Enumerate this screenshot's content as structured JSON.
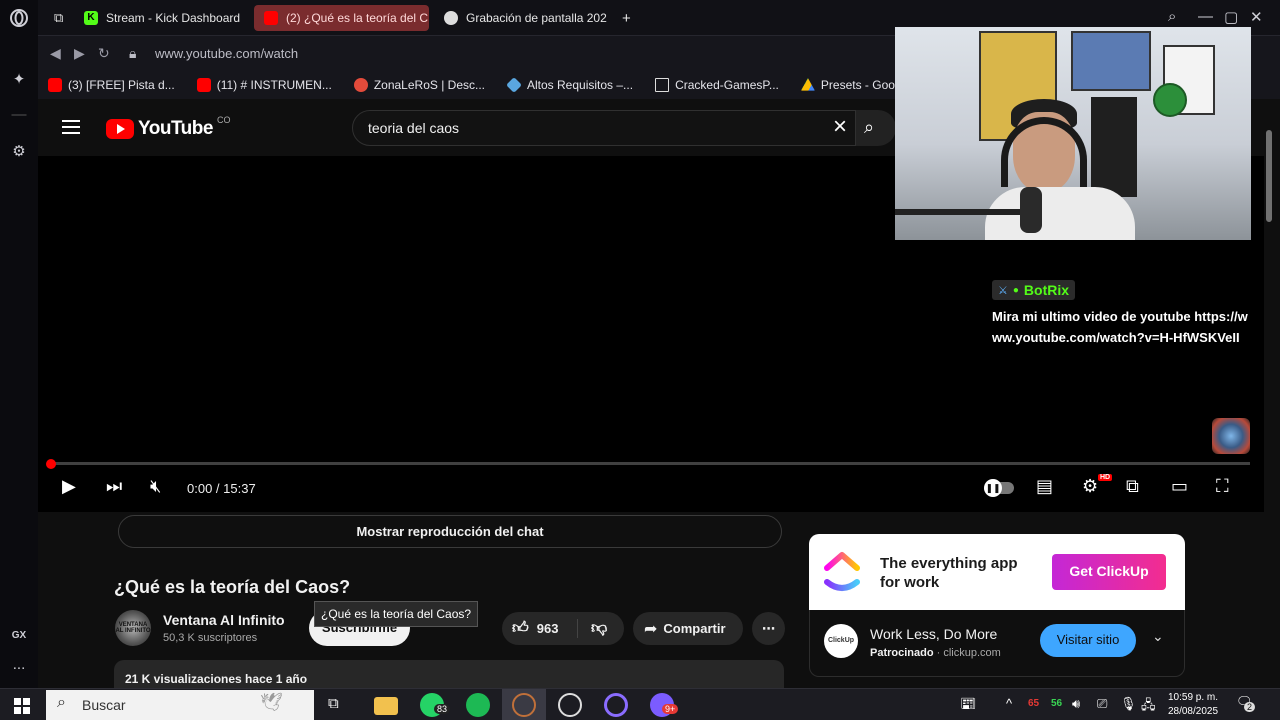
{
  "browser": {
    "tabs": [
      {
        "label": "Stream - Kick Dashboard",
        "favicon": "kick-icon",
        "active": false
      },
      {
        "label": "(2) ¿Qué es la teoría del C",
        "favicon": "youtube-icon",
        "active": true
      },
      {
        "label": "Grabación de pantalla 202",
        "favicon": "chrome-icon",
        "active": false
      }
    ],
    "new_tab": "+",
    "url": "www.youtube.com/watch",
    "bookmarks": [
      {
        "label": "(3) [FREE] Pista d...",
        "icon": "youtube-icon"
      },
      {
        "label": "(11) # INSTRUMEN...",
        "icon": "youtube-icon"
      },
      {
        "label": "ZonaLeRoS | Desc...",
        "icon": "zona-icon"
      },
      {
        "label": "Altos Requisitos –...",
        "icon": "diamond-icon"
      },
      {
        "label": "Cracked-GamesP...",
        "icon": "page-icon"
      },
      {
        "label": "Presets - Google...",
        "icon": "drive-icon"
      }
    ],
    "sidebar_gx": "GX",
    "sidebar_more": "..."
  },
  "youtube": {
    "logo_text": "YouTube",
    "country": "CO",
    "search_value": "teoria del caos",
    "player": {
      "time": "0:00 / 15:37",
      "progress": 0.0,
      "hd_badge": "HD"
    },
    "chat_replay": "Mostrar reproducción del chat",
    "video_title": "¿Qué es la teoría del Caos?",
    "tooltip": "¿Qué es la teoría del Caos?",
    "channel": {
      "name": "Ventana Al Infinito",
      "subscribers": "50,3 K suscriptores",
      "avatar_text": "VENTANA AL INFINITO",
      "subscribe_label": "Suscribirme"
    },
    "likes": "963",
    "share_label": "Compartir",
    "more_label": "⋯",
    "views_line": "21 K visualizaciones  hace 1 año",
    "ad": {
      "tagline_line1": "The everything app",
      "tagline_line2": "for work",
      "cta": "Get ClickUp",
      "headline": "Work Less, Do More",
      "sponsored": "Patrocinado",
      "domain": "clickup.com",
      "visit": "Visitar sitio",
      "small_logo_text": "ClickUp"
    }
  },
  "overlay": {
    "bot_name": "BotRix",
    "bot_message": "Mira mi ultimo video de youtube https://www.youtube.com/watch?v=H-HfWSKVeII"
  },
  "taskbar": {
    "search_label": "Buscar",
    "whatsapp_badge": "83",
    "discord_badge": "9+",
    "tray_red": "65",
    "tray_green": "56",
    "time": "10:59 p. m.",
    "date": "28/08/2025",
    "notifications": "2"
  },
  "colors": {
    "youtube_red": "#ff0000",
    "kick_green": "#53fc18",
    "active_tab": "#7a2c2e",
    "link_blue": "#3ea6ff"
  }
}
